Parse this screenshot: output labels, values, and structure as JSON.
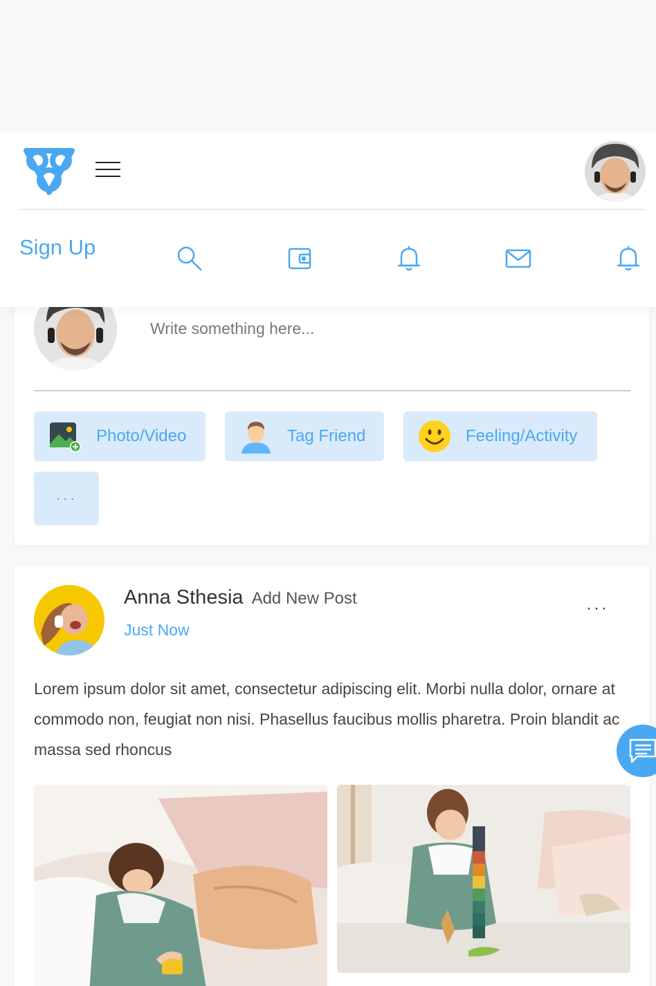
{
  "header": {
    "signup_label": "Sign Up"
  },
  "composer": {
    "placeholder": "Write something here...",
    "actions": [
      {
        "label": "Photo/Video",
        "icon": "photo-video-icon"
      },
      {
        "label": "Tag Friend",
        "icon": "tag-friend-icon"
      },
      {
        "label": "Feeling/Activity",
        "icon": "smiley-icon"
      }
    ],
    "more_label": "···"
  },
  "post": {
    "author": "Anna Sthesia",
    "action": "Add New Post",
    "time": "Just Now",
    "menu_label": "···",
    "body": "Lorem ipsum dolor sit amet, consectetur adipiscing elit. Morbi nulla dolor, ornare at commodo non, feugiat non nisi. Phasellus faucibus mollis pharetra. Proin blandit ac massa sed rhoncus"
  },
  "colors": {
    "accent": "#4aa8f0",
    "button_bg": "#d9ebfb",
    "page_bg": "#f7f8fa"
  }
}
